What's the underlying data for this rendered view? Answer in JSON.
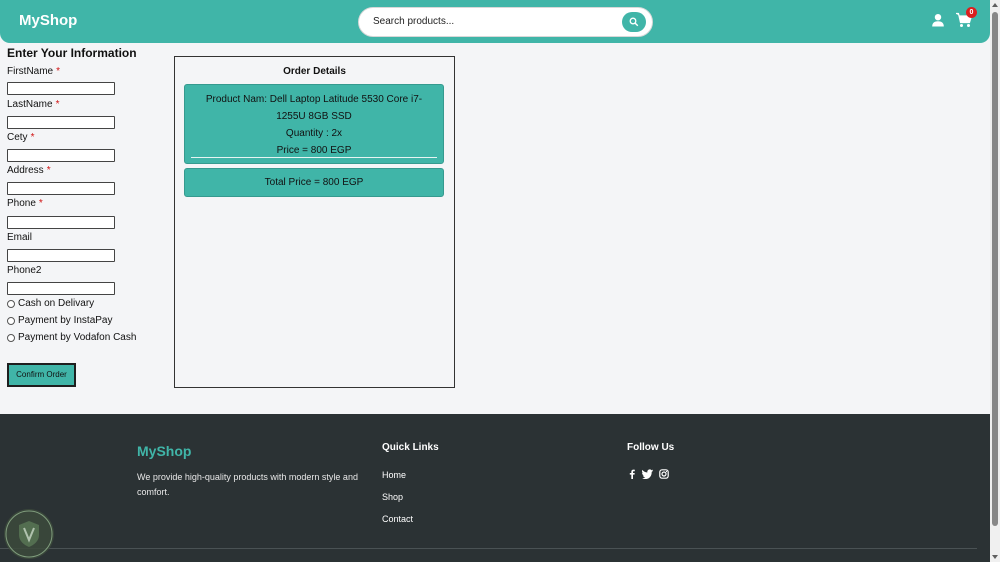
{
  "header": {
    "logo": "MyShop",
    "search_placeholder": "Search products...",
    "cart_count": "0"
  },
  "form": {
    "title": "Enter Your Information",
    "fields": [
      {
        "label": "FirstName",
        "required": true
      },
      {
        "label": "LastName",
        "required": true
      },
      {
        "label": "Cety",
        "required": true
      },
      {
        "label": "Address",
        "required": true
      },
      {
        "label": "Phone",
        "required": true
      },
      {
        "label": "Email",
        "required": false
      },
      {
        "label": "Phone2",
        "required": false
      }
    ],
    "required_mark": "*",
    "payment_options": [
      "Cash on Delivary",
      "Payment by InstaPay",
      "Payment by Vodafon Cash"
    ],
    "confirm_label": "Confirm Order"
  },
  "order": {
    "title": "Order Details",
    "item_name": "Product Nam: Dell Laptop Latitude 5530 Core i7-1255U 8GB SSD",
    "quantity": "Quantity : 2x",
    "price": "Price = 800 EGP",
    "total": "Total Price = 800 EGP"
  },
  "footer": {
    "brand": "MyShop",
    "description": "We provide high-quality products with modern style and comfort.",
    "quick_links_heading": "Quick Links",
    "links": [
      "Home",
      "Shop",
      "Contact"
    ],
    "follow_heading": "Follow Us"
  },
  "colors": {
    "accent": "#40b5a8",
    "footer_bg": "#2b3234",
    "required": "#d01010",
    "badge": "#dc1f1f"
  },
  "icons": [
    "search-icon",
    "user-icon",
    "cart-icon",
    "facebook-icon",
    "twitter-icon",
    "instagram-icon"
  ]
}
